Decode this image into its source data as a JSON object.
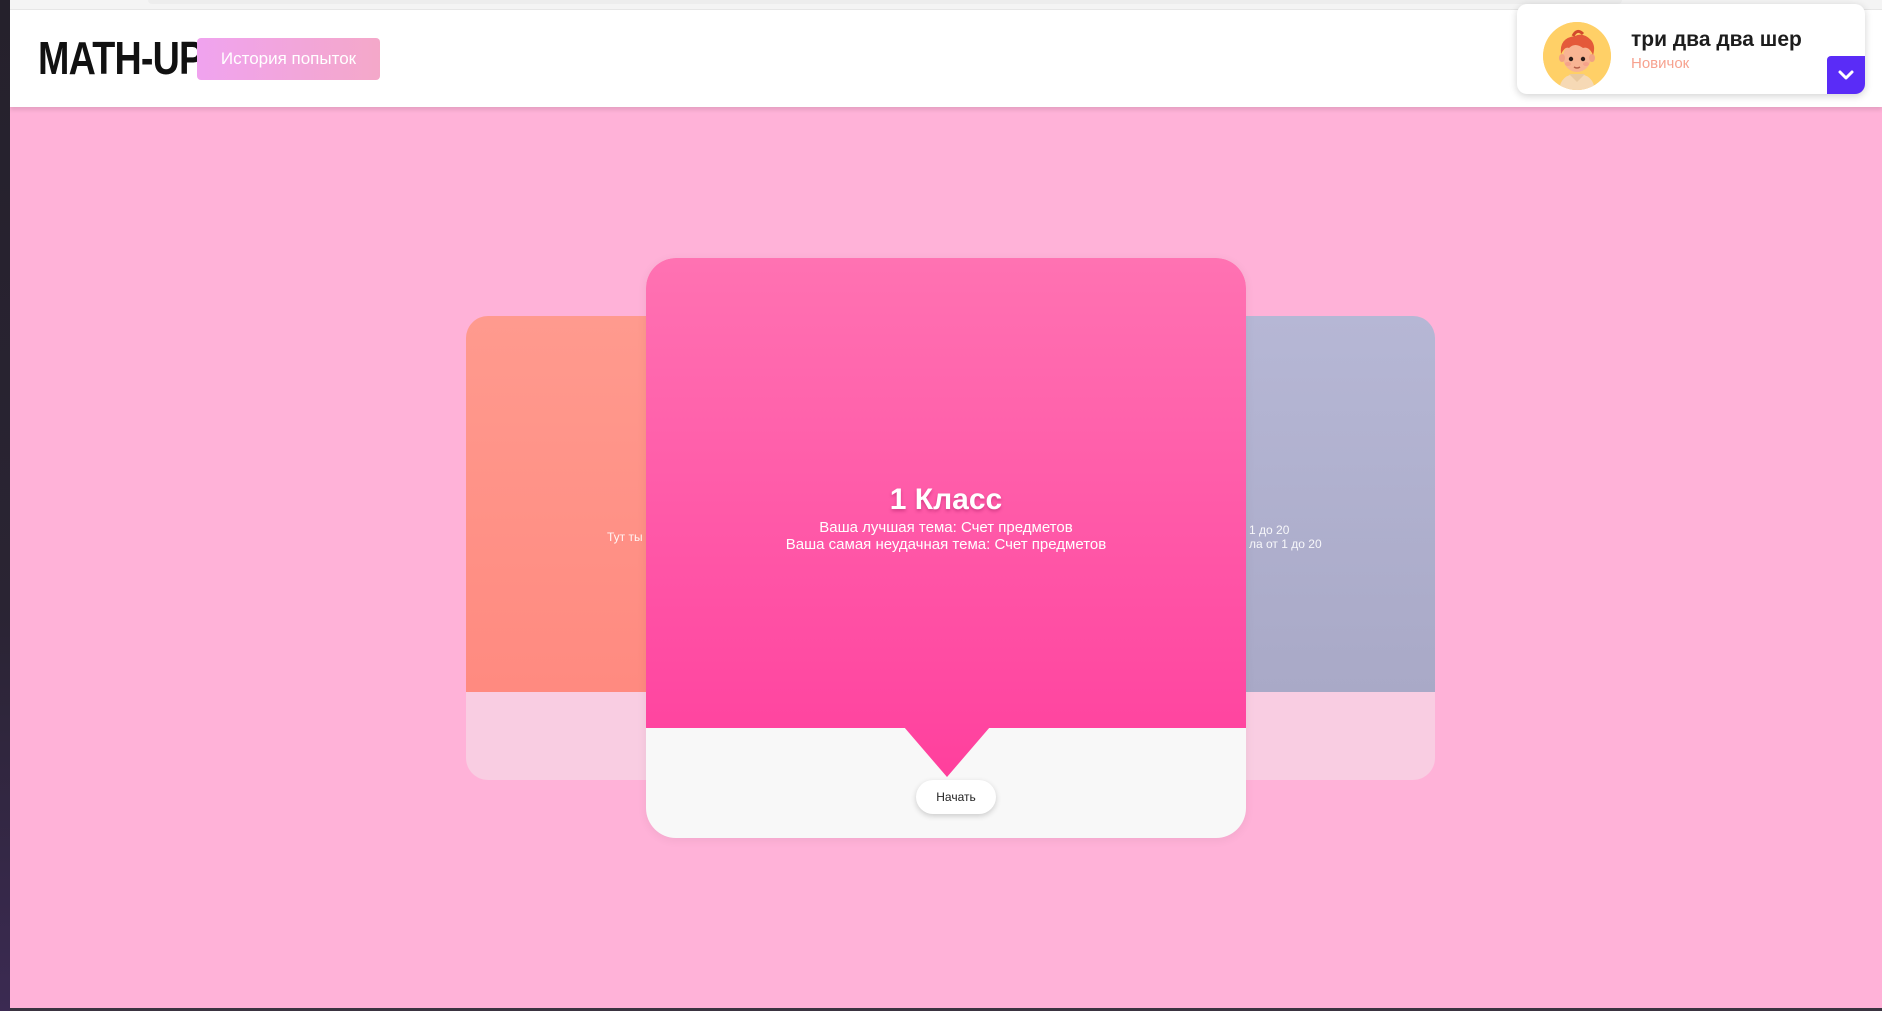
{
  "header": {
    "logo": "MATH-UP",
    "history_button": "История попыток"
  },
  "profile": {
    "name": "три два два шер",
    "rank": "Новичок",
    "avatar_icon": "child-avatar-icon",
    "toggle_icon": "chevron-down-icon"
  },
  "cards": {
    "left": {
      "text_fragment": "Тут ты с"
    },
    "right": {
      "line1_fragment": "1 до 20",
      "line2_fragment": "ла от 1 до 20"
    },
    "main": {
      "title": "1 Класс",
      "best_topic": "Ваша лучшая тема: Счет предметов",
      "worst_topic": "Ваша самая неудачная тема: Счет предметов",
      "start_button": "Начать"
    }
  },
  "colors": {
    "background": "#ffb2d8",
    "main_card_gradient_top": "#ff72b2",
    "main_card_gradient_bottom": "#ff45a0",
    "left_card": "#ff9388",
    "right_card": "#b0b1cf",
    "accent": "#5a2cf7",
    "rank": "#f7a28f"
  }
}
